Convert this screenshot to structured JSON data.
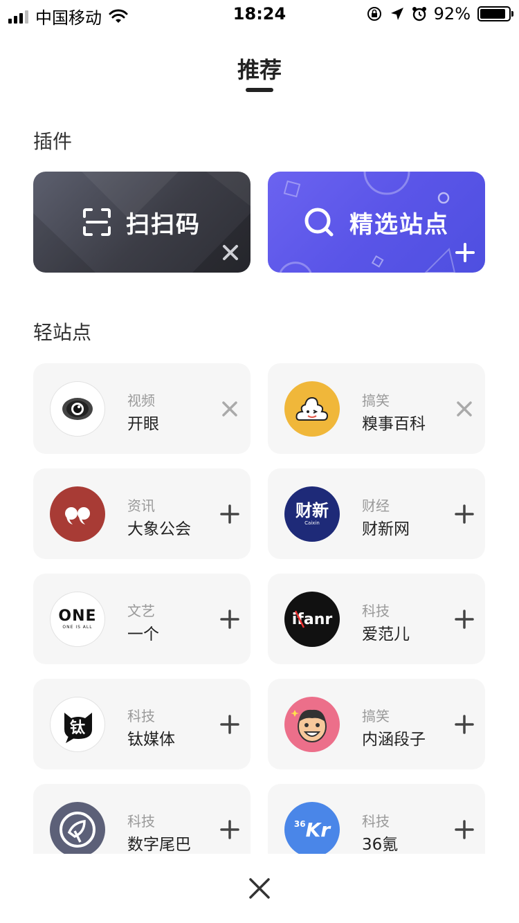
{
  "status": {
    "carrier": "中国移动",
    "time": "18:24",
    "battery": "92%"
  },
  "header": {
    "title": "推荐"
  },
  "sections": {
    "plugins": "插件",
    "sites": "轻站点"
  },
  "plugins": [
    {
      "label": "扫扫码"
    },
    {
      "label": "精选站点"
    }
  ],
  "sites": [
    {
      "category": "视频",
      "name": "开眼",
      "action": "remove"
    },
    {
      "category": "搞笑",
      "name": "糗事百科",
      "action": "remove"
    },
    {
      "category": "资讯",
      "name": "大象公会",
      "action": "add"
    },
    {
      "category": "财经",
      "name": "财新网",
      "action": "add"
    },
    {
      "category": "文艺",
      "name": "一个",
      "action": "add"
    },
    {
      "category": "科技",
      "name": "爱范儿",
      "action": "add"
    },
    {
      "category": "科技",
      "name": "钛媒体",
      "action": "add"
    },
    {
      "category": "搞笑",
      "name": "内涵段子",
      "action": "add"
    },
    {
      "category": "科技",
      "name": "数字尾巴",
      "action": "add"
    },
    {
      "category": "科技",
      "name": "36氪",
      "action": "add"
    }
  ],
  "logos": {
    "caixin_main": "财新",
    "caixin_sub": "Caixin",
    "one_main": "ONE",
    "one_sub": "ONE IS ALL",
    "ifanr": "ifanr",
    "tmt": "钛",
    "kr_small": "36",
    "kr_big": "Kr"
  },
  "colors": {
    "plugin_scan_bg": "#3c3d46",
    "plugin_site_bg": "#5a55e8",
    "card_bg": "#f6f6f6",
    "qiushi": "#f0b73a",
    "daxiang": "#a83b35",
    "caixin": "#1e2a78",
    "ifanr": "#111111",
    "neihan": "#ec6f8a",
    "weiba": "#5c6078",
    "kr36": "#4a86e8"
  }
}
